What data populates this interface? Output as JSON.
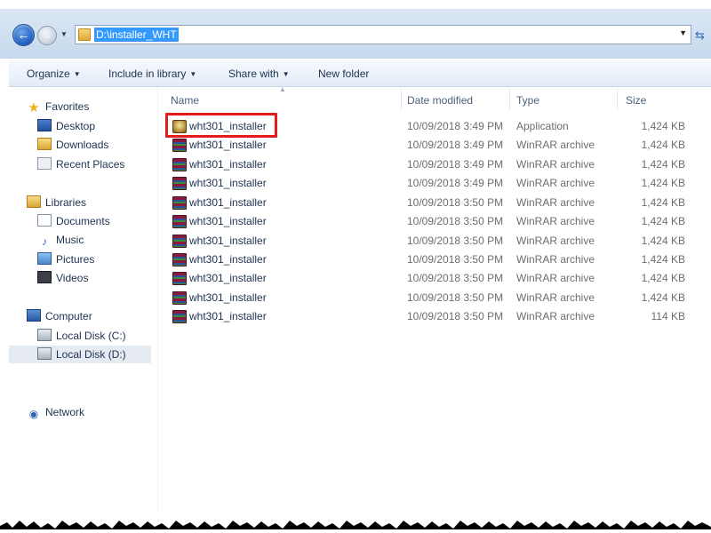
{
  "address": {
    "path": "D:\\installer_WHT"
  },
  "toolbar": {
    "organize": "Organize",
    "include_in_library": "Include in library",
    "share_with": "Share with",
    "new_folder": "New folder"
  },
  "nav": {
    "favorites": "Favorites",
    "desktop": "Desktop",
    "downloads": "Downloads",
    "recent_places": "Recent Places",
    "libraries": "Libraries",
    "documents": "Documents",
    "music": "Music",
    "pictures": "Pictures",
    "videos": "Videos",
    "computer": "Computer",
    "local_disk_c": "Local Disk (C:)",
    "local_disk_d": "Local Disk (D:)",
    "network": "Network"
  },
  "columns": {
    "name": "Name",
    "date_modified": "Date modified",
    "type": "Type",
    "size": "Size"
  },
  "files": [
    {
      "name": "wht301_installer",
      "date": "10/09/2018 3:49 PM",
      "type": "Application",
      "size": "1,424 KB",
      "icon": "application-icon"
    },
    {
      "name": "wht301_installer",
      "date": "10/09/2018 3:49 PM",
      "type": "WinRAR archive",
      "size": "1,424 KB",
      "icon": "winrar-icon"
    },
    {
      "name": "wht301_installer",
      "date": "10/09/2018 3:49 PM",
      "type": "WinRAR archive",
      "size": "1,424 KB",
      "icon": "winrar-icon"
    },
    {
      "name": "wht301_installer",
      "date": "10/09/2018 3:49 PM",
      "type": "WinRAR archive",
      "size": "1,424 KB",
      "icon": "winrar-icon"
    },
    {
      "name": "wht301_installer",
      "date": "10/09/2018 3:50 PM",
      "type": "WinRAR archive",
      "size": "1,424 KB",
      "icon": "winrar-icon"
    },
    {
      "name": "wht301_installer",
      "date": "10/09/2018 3:50 PM",
      "type": "WinRAR archive",
      "size": "1,424 KB",
      "icon": "winrar-icon"
    },
    {
      "name": "wht301_installer",
      "date": "10/09/2018 3:50 PM",
      "type": "WinRAR archive",
      "size": "1,424 KB",
      "icon": "winrar-icon"
    },
    {
      "name": "wht301_installer",
      "date": "10/09/2018 3:50 PM",
      "type": "WinRAR archive",
      "size": "1,424 KB",
      "icon": "winrar-icon"
    },
    {
      "name": "wht301_installer",
      "date": "10/09/2018 3:50 PM",
      "type": "WinRAR archive",
      "size": "1,424 KB",
      "icon": "winrar-icon"
    },
    {
      "name": "wht301_installer",
      "date": "10/09/2018 3:50 PM",
      "type": "WinRAR archive",
      "size": "1,424 KB",
      "icon": "winrar-icon"
    },
    {
      "name": "wht301_installer",
      "date": "10/09/2018 3:50 PM",
      "type": "WinRAR archive",
      "size": "114 KB",
      "icon": "winrar-icon"
    }
  ],
  "colors": {
    "highlight_border": "#e31b1b",
    "selection_blue": "#3399ff"
  }
}
